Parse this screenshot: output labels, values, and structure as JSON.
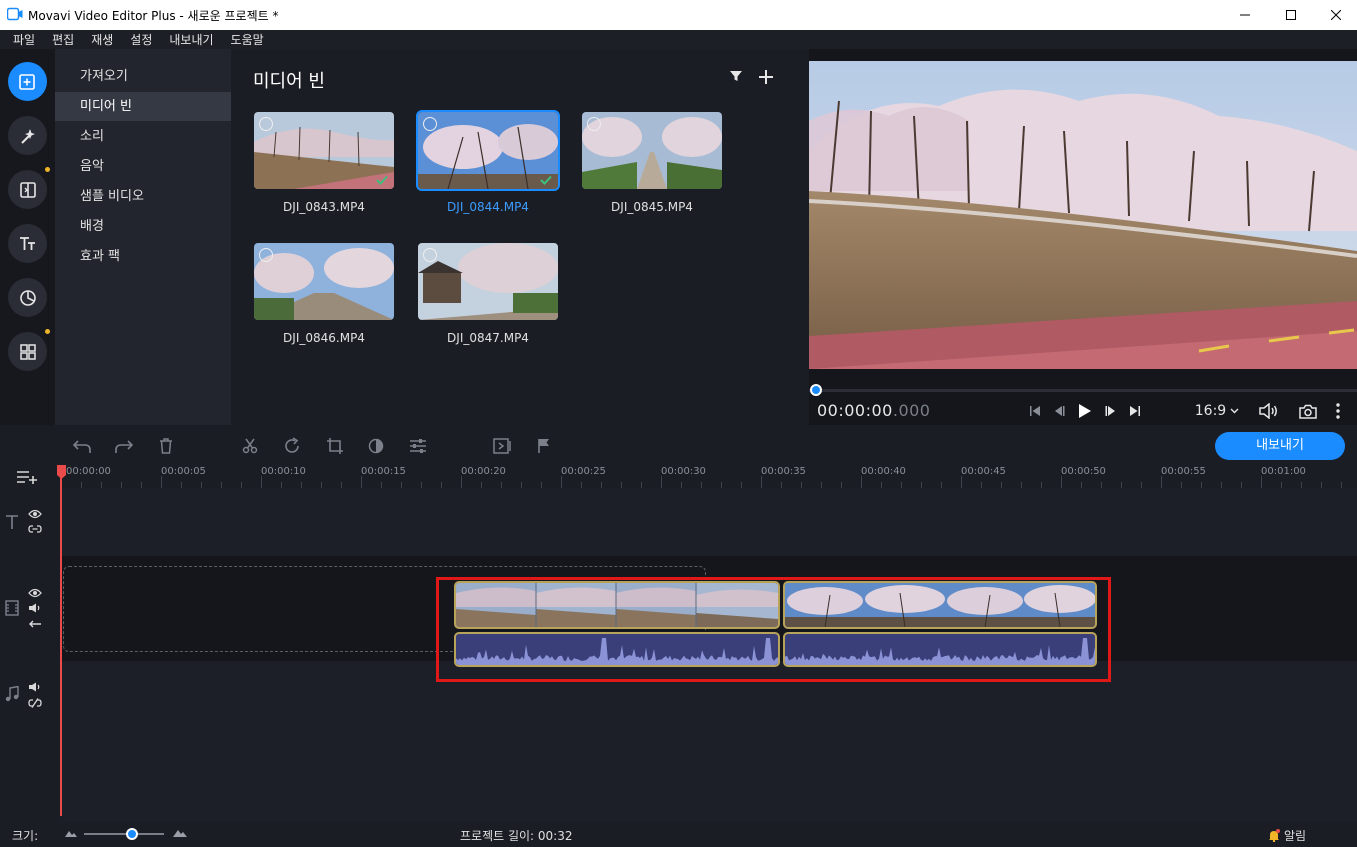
{
  "window": {
    "title": "Movavi Video Editor Plus - 새로운 프로젝트 *"
  },
  "menu": [
    "파일",
    "편집",
    "재생",
    "설정",
    "내보내기",
    "도움말"
  ],
  "tools": [
    {
      "name": "import-icon",
      "active": true
    },
    {
      "name": "filters-icon",
      "active": false
    },
    {
      "name": "transitions-icon",
      "active": false,
      "dot": true
    },
    {
      "name": "titles-icon",
      "active": false
    },
    {
      "name": "stickers-icon",
      "active": false
    },
    {
      "name": "more-tools-icon",
      "active": false,
      "dot": true
    }
  ],
  "categories": [
    "가져오기",
    "미디어 빈",
    "소리",
    "음악",
    "샘플 비디오",
    "배경",
    "효과 팩"
  ],
  "active_category": 1,
  "bin": {
    "title": "미디어 빈",
    "items": [
      {
        "name": "DJI_0843.MP4",
        "used": true
      },
      {
        "name": "DJI_0844.MP4",
        "used": true,
        "selected": true
      },
      {
        "name": "DJI_0845.MP4",
        "used": false
      },
      {
        "name": "DJI_0846.MP4",
        "used": false
      },
      {
        "name": "DJI_0847.MP4",
        "used": false
      }
    ]
  },
  "player": {
    "time_main": "00:00:00",
    "time_ms": ".000",
    "aspect": "16:9"
  },
  "export_label": "내보내기",
  "ruler": [
    "00:00:00",
    "00:00:05",
    "00:00:10",
    "00:00:15",
    "00:00:20",
    "00:00:25",
    "00:00:30",
    "00:00:35",
    "00:00:40",
    "00:00:45",
    "00:00:50",
    "00:00:55",
    "00:01:00"
  ],
  "status": {
    "scale_label": "크기:",
    "project_length": "프로젝트 길이: 00:32",
    "notifications": "알림"
  }
}
